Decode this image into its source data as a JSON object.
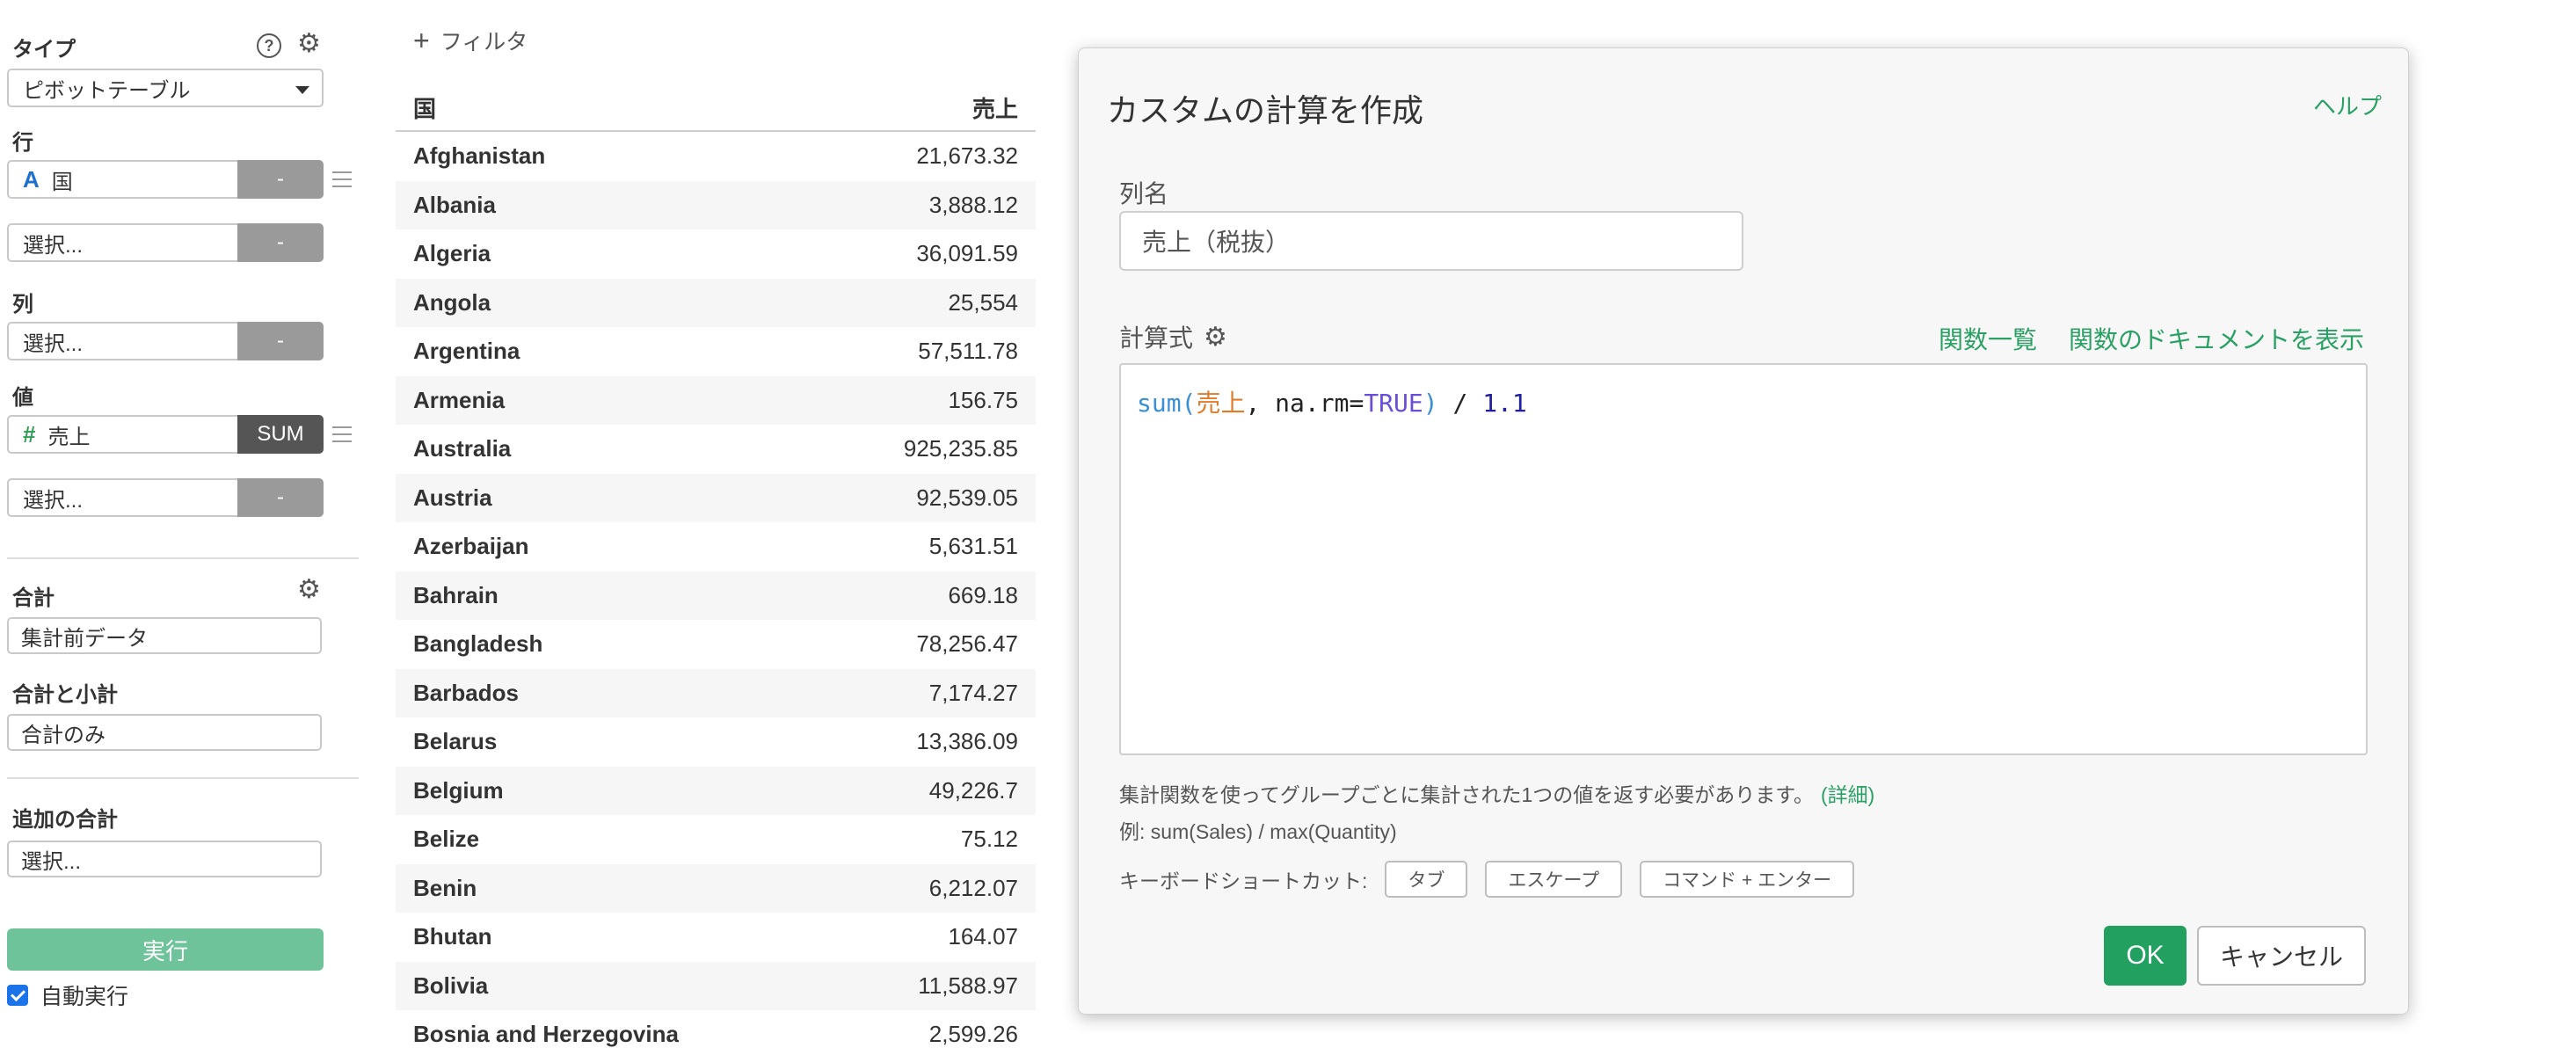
{
  "sidebar": {
    "type_label": "タイプ",
    "help_icon": "?",
    "type_value": "ピボットテーブル",
    "rows_label": "行",
    "rows_field": {
      "type_icon": "A",
      "name": "国",
      "btn": "-"
    },
    "rows_select": {
      "placeholder": "選択...",
      "btn": "-"
    },
    "cols_label": "列",
    "cols_select": {
      "placeholder": "選択...",
      "btn": "-"
    },
    "values_label": "値",
    "values_field": {
      "type_icon": "#",
      "name": "売上",
      "btn": "SUM"
    },
    "values_select": {
      "placeholder": "選択...",
      "btn": "-"
    },
    "total_label": "合計",
    "total_value": "集計前データ",
    "subtotal_label": "合計と小計",
    "subtotal_value": "合計のみ",
    "additional_total_label": "追加の合計",
    "additional_total_placeholder": "選択...",
    "run_label": "実行",
    "auto_run_label": "自動実行"
  },
  "filter_label": "フィルタ",
  "table": {
    "headers": {
      "country": "国",
      "sales": "売上"
    },
    "rows": [
      {
        "country": "Afghanistan",
        "sales": "21,673.32"
      },
      {
        "country": "Albania",
        "sales": "3,888.12"
      },
      {
        "country": "Algeria",
        "sales": "36,091.59"
      },
      {
        "country": "Angola",
        "sales": "25,554"
      },
      {
        "country": "Argentina",
        "sales": "57,511.78"
      },
      {
        "country": "Armenia",
        "sales": "156.75"
      },
      {
        "country": "Australia",
        "sales": "925,235.85"
      },
      {
        "country": "Austria",
        "sales": "92,539.05"
      },
      {
        "country": "Azerbaijan",
        "sales": "5,631.51"
      },
      {
        "country": "Bahrain",
        "sales": "669.18"
      },
      {
        "country": "Bangladesh",
        "sales": "78,256.47"
      },
      {
        "country": "Barbados",
        "sales": "7,174.27"
      },
      {
        "country": "Belarus",
        "sales": "13,386.09"
      },
      {
        "country": "Belgium",
        "sales": "49,226.7"
      },
      {
        "country": "Belize",
        "sales": "75.12"
      },
      {
        "country": "Benin",
        "sales": "6,212.07"
      },
      {
        "country": "Bhutan",
        "sales": "164.07"
      },
      {
        "country": "Bolivia",
        "sales": "11,588.97"
      },
      {
        "country": "Bosnia and Herzegovina",
        "sales": "2,599.26"
      }
    ]
  },
  "dialog": {
    "title": "カスタムの計算を作成",
    "help": "ヘルプ",
    "column_name_label": "列名",
    "column_name_value": "売上（税抜）",
    "formula_label": "計算式",
    "function_list_link": "関数一覧",
    "function_doc_link": "関数のドキュメントを表示",
    "formula": {
      "fn": "sum(",
      "col": "売上",
      "mid": ", na.rm=",
      "const": "TRUE",
      "close": ")",
      "op": " / ",
      "num": "1.1"
    },
    "hint": "集計関数を使ってグループごとに集計された1つの値を返す必要があります。",
    "hint_link": "(詳細)",
    "example": "例: sum(Sales) / max(Quantity)",
    "shortcuts_label": "キーボードショートカット:",
    "shortcut_keys": [
      "タブ",
      "エスケープ",
      "コマンド + エンター"
    ],
    "ok": "OK",
    "cancel": "キャンセル"
  },
  "colors": {
    "accent_green": "#22a060",
    "run_button": "#6fc39a",
    "string_icon": "#1f6fd0",
    "number_icon": "#2e9e55"
  }
}
